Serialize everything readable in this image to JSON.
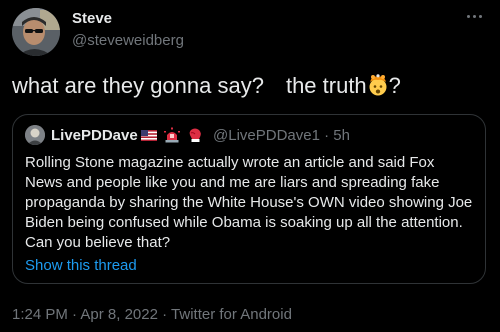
{
  "tweet": {
    "author": {
      "name": "Steve",
      "handle": "@steveweidberg",
      "avatar_icon": "profile-photo"
    },
    "more_icon": "more-horizontal-icon",
    "text_before": "what are they gonna say?",
    "text_middle": "the truth",
    "text_after": "?",
    "emoji": "exploding-head-emoji",
    "quote": {
      "author_name": "LivePDDave",
      "badges": [
        "us-flag-icon",
        "police-light-icon",
        "boxing-glove-icon"
      ],
      "handle": "@LivePDDave1",
      "separator": "·",
      "time": "5h",
      "body_lines": [
        "Rolling Stone magazine actually wrote an article and said Fox",
        "News and people like you and me are liars and spreading fake",
        "propaganda by sharing the White House's OWN video showing Joe",
        "Biden being confused while Obama is soaking up all the attention.",
        "Can you believe that?"
      ],
      "show_thread": "Show this thread"
    },
    "timestamp": {
      "time": "1:24 PM",
      "sep1": "·",
      "date": "Apr 8, 2022",
      "sep2": "·",
      "source": "Twitter for Android"
    }
  },
  "colors": {
    "background": "#000000",
    "text": "#e7e9ea",
    "secondary": "#71767b",
    "link": "#1d9bf0",
    "border": "#2f3336"
  }
}
